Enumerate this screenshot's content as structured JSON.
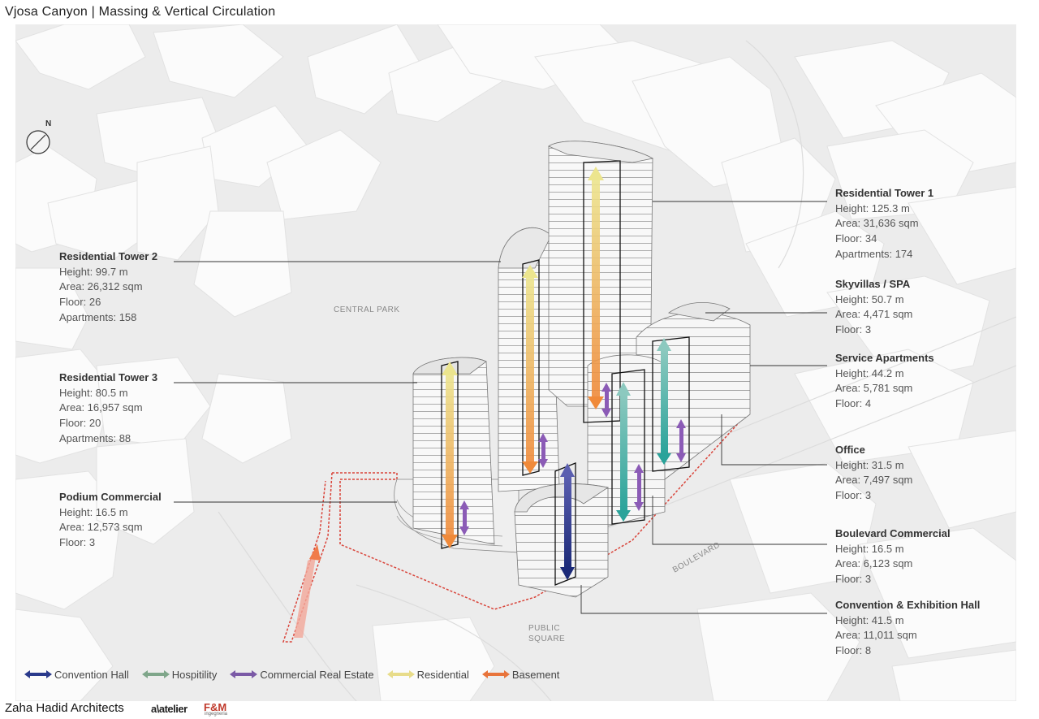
{
  "title": "Vjosa Canyon | Massing & Vertical Circulation",
  "compass": {
    "letter": "N",
    "icon": "north-arrow-icon"
  },
  "site_labels": {
    "central_park": "CENTRAL PARK",
    "boulevard": "BOULEVARD",
    "public_square_1": "PUBLIC",
    "public_square_2": "SQUARE"
  },
  "buildings": [
    {
      "name": "Residential Tower 1",
      "height": "Height: 125.3 m",
      "area": "Area: 31,636 sqm",
      "floor": "Floor: 34",
      "apartments": "Apartments: 174"
    },
    {
      "name": "Residential Tower 2",
      "height": "Height: 99.7 m",
      "area": "Area: 26,312 sqm",
      "floor": "Floor: 26",
      "apartments": "Apartments: 158"
    },
    {
      "name": "Skyvillas / SPA",
      "height": "Height: 50.7 m",
      "area": "Area: 4,471 sqm",
      "floor": "Floor: 3"
    },
    {
      "name": "Residential Tower 3",
      "height": "Height: 80.5 m",
      "area": "Area: 16,957 sqm",
      "floor": "Floor: 20",
      "apartments": "Apartments: 88"
    },
    {
      "name": "Service Apartments",
      "height": "Height: 44.2 m",
      "area": "Area: 5,781 sqm",
      "floor": "Floor: 4"
    },
    {
      "name": "Office",
      "height": "Height: 31.5 m",
      "area": "Area: 7,497 sqm",
      "floor": "Floor: 3"
    },
    {
      "name": "Podium Commercial",
      "height": "Height: 16.5 m",
      "area": "Area: 12,573 sqm",
      "floor": "Floor: 3"
    },
    {
      "name": "Boulevard Commercial",
      "height": "Height: 16.5 m",
      "area": "Area: 6,123 sqm",
      "floor": "Floor: 3"
    },
    {
      "name": "Convention & Exhibition Hall",
      "height": "Height: 41.5 m",
      "area": "Area: 11,011 sqm",
      "floor": "Floor: 8"
    }
  ],
  "legend": [
    {
      "label": "Convention Hall",
      "color": "#2a3a8c"
    },
    {
      "label": "Hospitility",
      "color": "#7fa68a"
    },
    {
      "label": "Commercial Real Estate",
      "color": "#7b5aa6"
    },
    {
      "label": "Residential",
      "color": "#e8dc8a"
    },
    {
      "label": "Basement",
      "color": "#e8743b"
    }
  ],
  "footer": {
    "firm": "Zaha Hadid Architects",
    "partner1": "a\\atelier",
    "partner2": "F&M",
    "partner2_sub": "ingegneria"
  },
  "colors": {
    "circulation_conv": "#2a3a8c",
    "circulation_hosp": "#3aa59a",
    "circulation_comm": "#8b5bb6",
    "circulation_res": "#e9d98a",
    "circulation_base": "#f07c4a",
    "site_outline": "#d9443a"
  }
}
